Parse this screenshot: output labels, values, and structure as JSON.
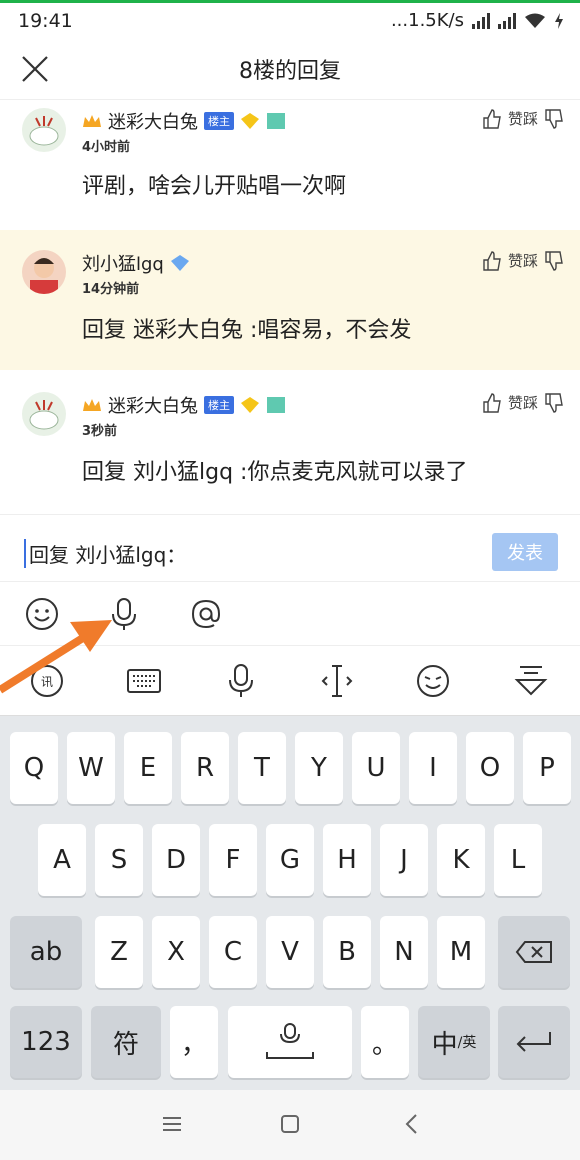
{
  "status": {
    "time": "19:41",
    "net": "...1.5K/s"
  },
  "header": {
    "title": "8楼的回复"
  },
  "posts": [
    {
      "name": "迷彩大白兔",
      "badge": "楼主",
      "time": "4小时前",
      "content": "评剧，啥会儿开贴唱一次啊",
      "like": "赞踩"
    },
    {
      "name": "刘小猛lgq",
      "time": "14分钟前",
      "content": "回复 迷彩大白兔 :唱容易，不会发",
      "like": "赞踩"
    },
    {
      "name": "迷彩大白兔",
      "badge": "楼主",
      "time": "3秒前",
      "content": "回复 刘小猛lgq :你点麦克风就可以录了",
      "like": "赞踩"
    }
  ],
  "reply": {
    "text": "回复 刘小猛lgq：",
    "send": "发表"
  },
  "keyboard": {
    "row1": [
      "Q",
      "W",
      "E",
      "R",
      "T",
      "Y",
      "U",
      "I",
      "O",
      "P"
    ],
    "row2": [
      "A",
      "S",
      "D",
      "F",
      "G",
      "H",
      "J",
      "K",
      "L"
    ],
    "row3": [
      "Z",
      "X",
      "C",
      "V",
      "B",
      "N",
      "M"
    ],
    "shift": "ab",
    "num": "123",
    "sym": "符",
    "comma": "，",
    "period": "。",
    "lang": "中",
    "lang_sub": "/英"
  },
  "colors": {
    "accent": "#3a6fe0",
    "highlight": "#fdf8e4",
    "send": "#a5c6f3",
    "arrow": "#f07b2b"
  }
}
